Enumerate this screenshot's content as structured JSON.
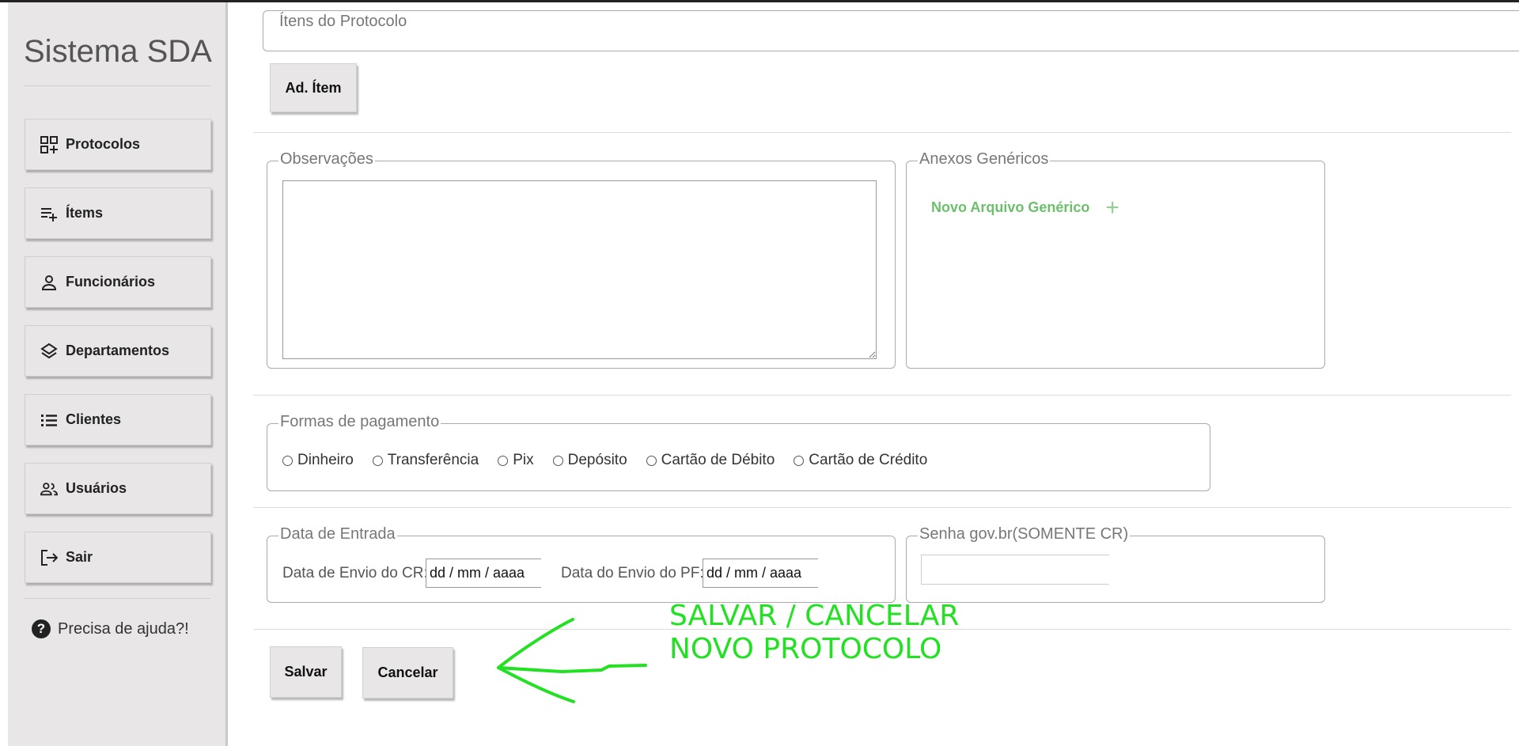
{
  "app": {
    "title": "Sistema SDA"
  },
  "sidebar": {
    "items": [
      {
        "label": "Protocolos",
        "icon": "grid-add-icon"
      },
      {
        "label": "Ítems",
        "icon": "playlist-add-icon"
      },
      {
        "label": "Funcionários",
        "icon": "person-icon"
      },
      {
        "label": "Departamentos",
        "icon": "layers-icon"
      },
      {
        "label": "Clientes",
        "icon": "list-icon"
      },
      {
        "label": "Usuários",
        "icon": "people-icon"
      },
      {
        "label": "Sair",
        "icon": "logout-icon"
      }
    ],
    "help": {
      "label": "Precisa de ajuda?!",
      "icon": "question-icon"
    }
  },
  "items_section": {
    "legend": "Ítens do Protocolo",
    "add_button": "Ad. Ítem"
  },
  "observations": {
    "legend": "Observações",
    "value": ""
  },
  "attachments": {
    "legend": "Anexos Genéricos",
    "new_file_label": "Novo Arquivo Genérico",
    "new_file_icon": "plus-icon",
    "accent_color": "#6cbf6c"
  },
  "payment": {
    "legend": "Formas de pagamento",
    "options": [
      "Dinheiro",
      "Transferência",
      "Pix",
      "Depósito",
      "Cartão de Débito",
      "Cartão de Crédito"
    ]
  },
  "entry_date": {
    "legend": "Data de Entrada",
    "cr_label": "Data de Envio do CR:",
    "cr_value": "dd / mm / aaaa",
    "pf_label": "Data do Envio do PF:",
    "pf_value": "dd / mm / aaaa"
  },
  "govbr": {
    "legend": "Senha gov.br(SOMENTE CR)",
    "value": ""
  },
  "actions": {
    "save": "Salvar",
    "cancel": "Cancelar"
  },
  "annotation": {
    "line1": "SALVAR / CANCELAR",
    "line2": "NOVO PROTOCOLO",
    "color": "#22e022"
  }
}
